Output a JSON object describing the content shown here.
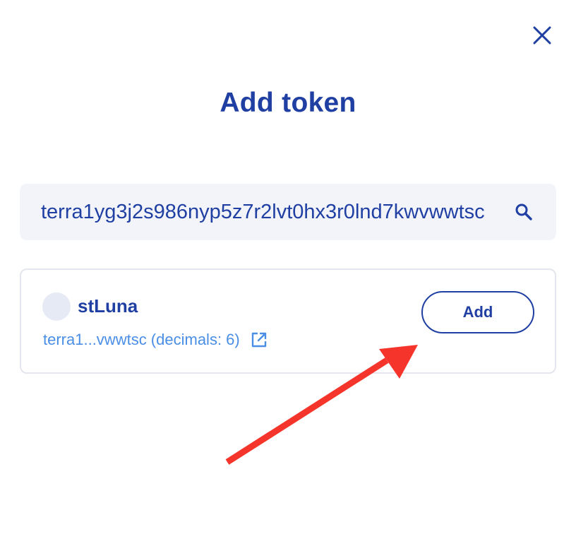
{
  "modal": {
    "title": "Add token"
  },
  "search": {
    "value": "terra1yg3j2s986nyp5z7r2lvt0hx3r0lnd7kwvwwtsc",
    "placeholder": "Search"
  },
  "token": {
    "name": "stLuna",
    "address_short": "terra1...vwwtsc (decimals: 6)",
    "add_label": "Add"
  },
  "icons": {
    "close": "close-icon",
    "search": "search-icon",
    "external_link": "external-link-icon",
    "annotation_arrow": "red-arrow-annotation"
  },
  "colors": {
    "primary": "#1f3fa3",
    "link": "#4a8ee6",
    "search_bg": "#f2f4fa",
    "annotation": "#f5352b"
  }
}
